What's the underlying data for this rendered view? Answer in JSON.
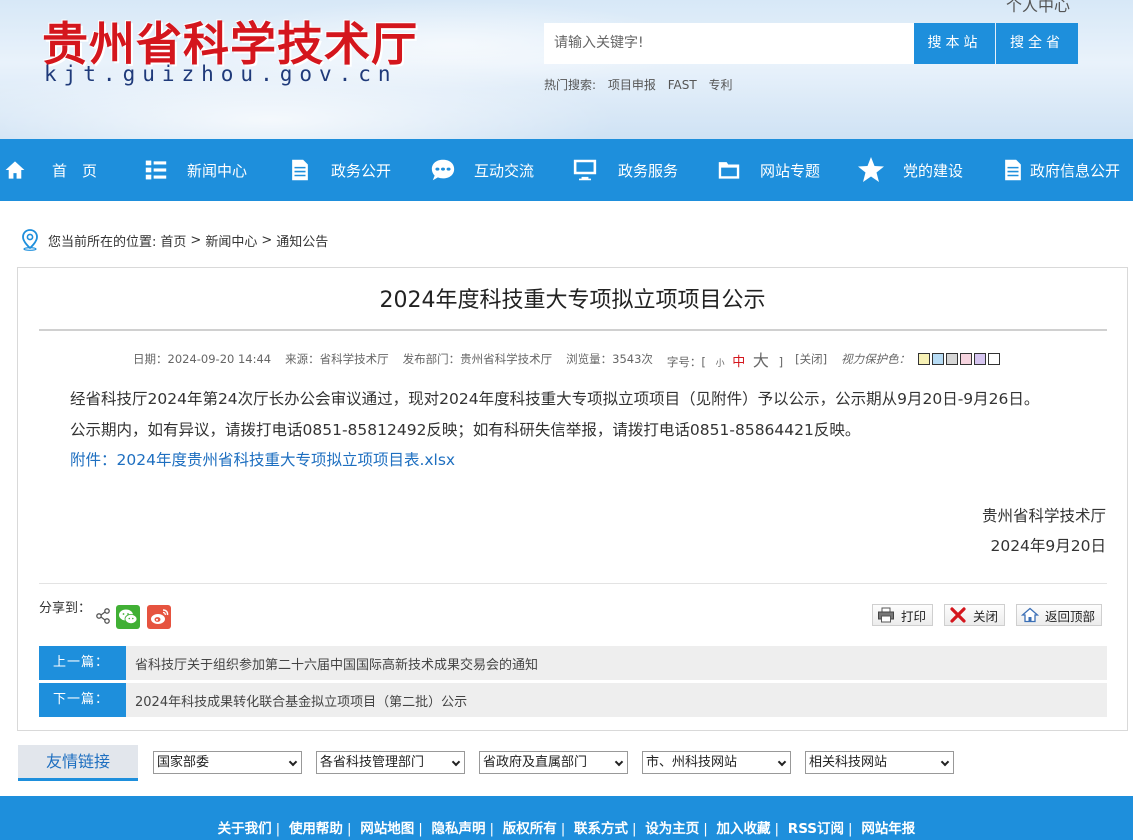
{
  "header": {
    "site_title": "贵州省科学技术厅",
    "domain": "kjt.guizhou.gov.cn",
    "personal_center": "个人中心",
    "search_placeholder": "请输入关键字!",
    "search_site_label": "搜本站",
    "search_province_label": "搜全省",
    "hot_label": "热门搜索:",
    "hot_terms": [
      "项目申报",
      "FAST",
      "专利"
    ]
  },
  "nav": {
    "items": [
      {
        "label": "首　页",
        "icon": "home-icon"
      },
      {
        "label": "新闻中心",
        "icon": "list-icon"
      },
      {
        "label": "政务公开",
        "icon": "document-icon"
      },
      {
        "label": "互动交流",
        "icon": "chat-icon"
      },
      {
        "label": "政务服务",
        "icon": "monitor-icon"
      },
      {
        "label": "网站专题",
        "icon": "folder-icon"
      },
      {
        "label": "党的建设",
        "icon": "star-icon"
      },
      {
        "label": "政府信息公开",
        "icon": "document-icon"
      }
    ]
  },
  "breadcrumb": {
    "prefix": "您当前所在的位置:",
    "items": [
      "首页",
      "新闻中心",
      "通知公告"
    ],
    "separator": ">"
  },
  "article": {
    "title": "2024年度科技重大专项拟立项项目公示",
    "meta": {
      "date": "日期：2024-09-20 14:44",
      "source": "来源：省科学技术厅",
      "department": "发布部门：贵州省科学技术厅",
      "views": "浏览量：3543次",
      "font_label": "字号：[",
      "font_small": "小",
      "font_medium": "中",
      "font_large": "大",
      "font_close": "]",
      "close_label": "[关闭]",
      "eye_label": "视力保护色：",
      "swatch_colors": [
        "#f7f1b5",
        "#b7dcf5",
        "#d6d6d6",
        "#f6d4df",
        "#d6c5f0",
        "#ffffff"
      ]
    },
    "paragraph1": "经省科技厅2024年第24次厅长办公会审议通过，现对2024年度科技重大专项拟立项项目（见附件）予以公示，公示期从9月20日-9月26日。",
    "paragraph2": "公示期内，如有异议，请拨打电话0851-85812492反映；如有科研失信举报，请拨打电话0851-85864421反映。",
    "attachment": "附件：2024年度贵州省科技重大专项拟立项项目表.xlsx",
    "signature": "贵州省科学技术厅",
    "sign_date": "2024年9月20日"
  },
  "share": {
    "label": "分享到："
  },
  "tools": {
    "print": "打印",
    "close": "关闭",
    "top": "返回顶部"
  },
  "prev_next": {
    "prev_label": "上一篇：",
    "prev_title": "省科技厅关于组织参加第二十六届中国国际高新技术成果交易会的通知",
    "next_label": "下一篇：",
    "next_title": "2024年科技成果转化联合基金拟立项项目（第二批）公示"
  },
  "friendly_links": {
    "tab": "友情链接",
    "selects": [
      "国家部委",
      "各省科技管理部门",
      "省政府及直属部门",
      "市、州科技网站",
      "相关科技网站"
    ]
  },
  "footer": {
    "links": [
      "关于我们",
      "使用帮助",
      "网站地图",
      "隐私声明",
      "版权所有",
      "联系方式",
      "设为主页",
      "加入收藏",
      "RSS订阅",
      "网站年报"
    ]
  },
  "colors": {
    "brand_blue": "#1e8fdc",
    "title_red": "#d4161d"
  }
}
